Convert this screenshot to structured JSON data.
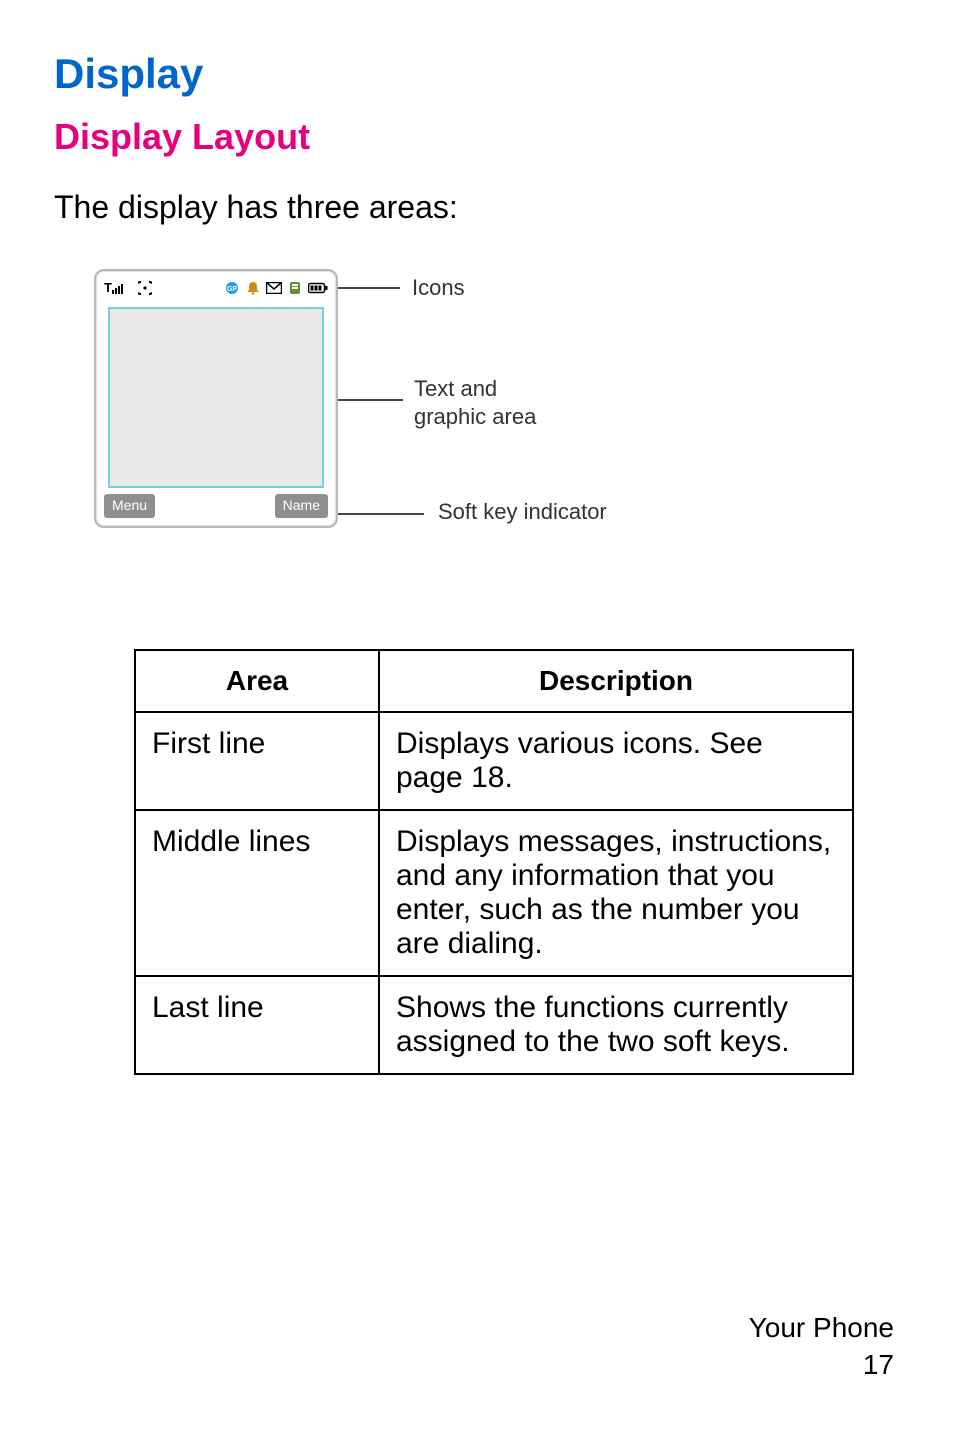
{
  "headings": {
    "h1": "Display",
    "h2": "Display Layout"
  },
  "intro": "The display has three areas:",
  "diagram": {
    "softkey_left": "Menu",
    "softkey_right": "Name",
    "callouts": {
      "icons": "Icons",
      "text_area_line1": "Text and",
      "text_area_line2": "graphic area",
      "softkey": "Soft key indicator"
    },
    "status_icons": [
      "signal-icon",
      "gprs-icon",
      "gp-indicator-icon",
      "alarm-icon",
      "message-icon",
      "voicemail-icon",
      "battery-icon"
    ]
  },
  "table": {
    "headers": {
      "area": "Area",
      "description": "Description"
    },
    "rows": [
      {
        "area": "First line",
        "description": "Displays various icons. See page 18."
      },
      {
        "area": "Middle lines",
        "description": "Displays messages, instructions, and any information that you enter, such as the number you are dialing."
      },
      {
        "area": "Last line",
        "description": "Shows the functions currently assigned to the two soft keys."
      }
    ]
  },
  "footer": {
    "section": "Your Phone",
    "page": "17"
  }
}
